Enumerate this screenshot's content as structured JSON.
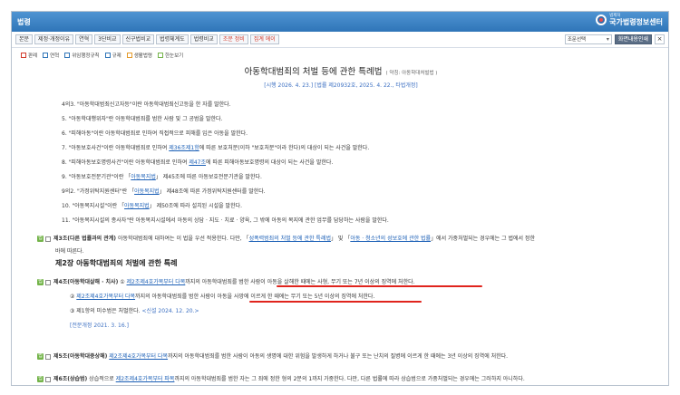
{
  "window": {
    "title": "법령"
  },
  "brand": {
    "small": "법제처",
    "big": "국가법령정보센터"
  },
  "toolbar": {
    "buttons": [
      "본문",
      "제정·개정이유",
      "연혁",
      "3단비교",
      "신구법비교",
      "법령체계도",
      "법령비교",
      "조문 정비",
      "집계 에이"
    ],
    "select_value": "조문선택",
    "print_label": "화면내용인쇄",
    "close_label": "×"
  },
  "subtools": [
    "판례",
    "연혁",
    "위임행정규칙",
    "규제",
    "생활법령",
    "한눈보기"
  ],
  "doc": {
    "title": "아동학대범죄의 처벌 등에 관한 특례법",
    "nickname": "( 약칭: 아동학대처벌법 )",
    "subtitle": "[시행 2026. 4. 23.] [법률 제20932호, 2025. 4. 22., 타법개정]"
  },
  "definitions": [
    {
      "pre": "4의3. \"아동학대범죄신고자등\"이란 아동학대범죄신고등을 한 자를 말한다.",
      "link": "",
      "post": ""
    },
    {
      "pre": "5. \"아동학대행위자\"란 아동학대범죄를 범한 사람 및 그 공범을 말한다.",
      "link": "",
      "post": ""
    },
    {
      "pre": "6. \"피해아동\"이란 아동학대범죄로 인하여 직접적으로 피해를 입은 아동을 말한다.",
      "link": "",
      "post": ""
    },
    {
      "pre": "7. \"아동보호사건\"이란 아동학대범죄로 인하여 ",
      "link": "제36조제1항",
      "post": "에 따른 보호처분(이하 \"보호처분\"이라 한다)의 대상이 되는 사건을 말한다."
    },
    {
      "pre": "8. \"피해아동보호명령사건\"이란 아동학대범죄로 인하여 ",
      "link": "제47조",
      "post": "에 따른 피해아동보호명령의 대상이 되는 사건을 말한다."
    },
    {
      "pre": "9. \"아동보호전문기관\"이란 「",
      "link": "아동복지법",
      "post": "」 제45조에 따른 아동보호전문기관을 말한다."
    },
    {
      "pre": "9의2. \"가정위탁지원센터\"란 「",
      "link": "아동복지법",
      "post": "」 제48조에 따른 가정위탁지원센터를 말한다."
    },
    {
      "pre": "10. \"아동복지시설\"이란 「",
      "link": "아동복지법",
      "post": "」 제50조에 따라 설치된 시설을 말한다."
    },
    {
      "pre": "11. \"아동복지시설의 종사자\"란 아동복지시설에서 아동의 상담 · 지도 · 치료 · 양육, 그 밖에 아동의 복지에 관한 업무를 담당하는 사람을 말한다.",
      "link": "",
      "post": ""
    }
  ],
  "article3": {
    "head": "제3조(다른 법률과의 관계)",
    "text_a": " 아동학대범죄에 대하여는 이 법을 우선 적용한다. 다만, 「",
    "link_a": "성폭력범죄의 처벌 등에 관한 특례법",
    "text_b": "」 및 「",
    "link_b": "아동 · 청소년의 성보호에 관한 법률",
    "text_c": "」에서 가중처벌되는 경우에는 그 법에서 정한",
    "text_d": "바에 따른다."
  },
  "chapter2": {
    "title": "제2장 아동학대범죄의 처벌에 관한 특례"
  },
  "article4": {
    "head": "제4조(아동학대살해 · 치사)",
    "p1_a": " ① ",
    "p1_link": "제2조제4호가목부터 다목",
    "p1_b": "까지의 ",
    "p1_hl": "아동학대범죄를 범한 사람이 아동을 살해한 때에는 사형, 무기 또는 7년 이상의 징역",
    "p1_c": "에 처한다.",
    "p2_a": "② ",
    "p2_link": "제2조제4호가목부터 다목",
    "p2_b": "까지의 아동학대범죄를 범한 사람이 ",
    "p2_hl": "아동을 사망에 이르게 한 때에는 무기 또는 5년 이상의 징역",
    "p2_c": "에 처한다.",
    "p3": "③ 제1항의 미수범은 처벌한다. ",
    "p3_note": "<신설 2024. 12. 20.>",
    "amend": "[전문개정 2021. 3. 16.]"
  },
  "article5": {
    "head": "제5조(아동학대중상해)",
    "a": " ",
    "link": "제2조제4호가목부터 다목",
    "b": "까지의 아동학대범죄를 범한 사람이 아동의 생명에 대한 위험을 발생하게 하거나 불구 또는 난치의 질병에 이르게 한 때에는 3년 이상의 징역에 처한다."
  },
  "article6": {
    "head": "제6조(상습범)",
    "a": " 상습적으로 ",
    "link": "제2조제4호가목부터 파목",
    "b": "까지의 아동학대범죄를 범한 자는 그 죄에 정한 형의 2분의 1까지 가중한다. 다만, 다른 법률에 따라 상습범으로 가중처벌되는 경우에는 그러하지 아니하다."
  },
  "colors": {
    "titlebar": "#2f75b8",
    "link": "#1b5fb6",
    "underline": "#e0241d",
    "icon_green": "#74b44a"
  },
  "icons": [
    "shield-logo-icon",
    "chevron-down-icon",
    "close-icon",
    "law-icon",
    "checkbox-icon"
  ]
}
